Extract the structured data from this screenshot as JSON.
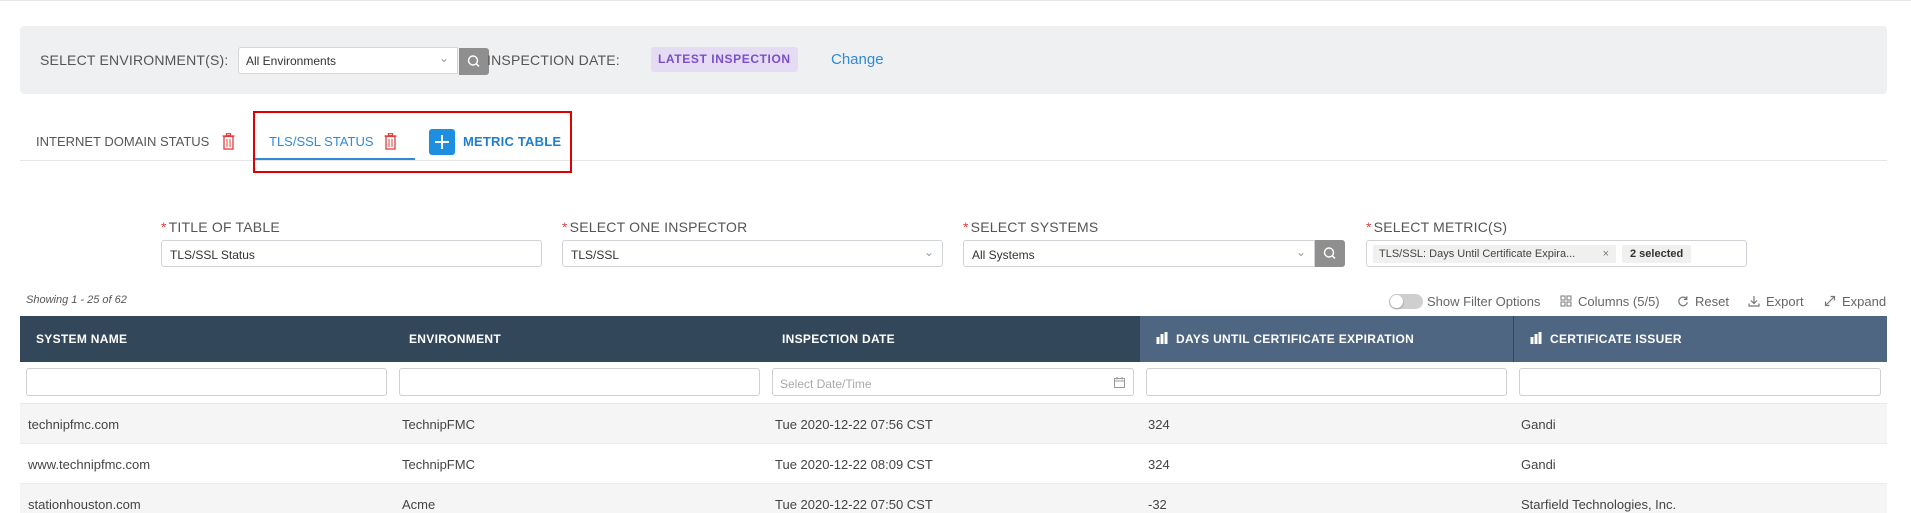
{
  "filter_bar": {
    "env_label": "SELECT ENVIRONMENT(S):",
    "env_value": "All Environments",
    "inspection_label": "INSPECTION DATE:",
    "inspection_badge": "LATEST INSPECTION",
    "change_link": "Change"
  },
  "tabs": [
    {
      "label": "INTERNET DOMAIN STATUS"
    },
    {
      "label": "TLS/SSL STATUS"
    }
  ],
  "add_tab_label": "METRIC TABLE",
  "form": {
    "title_label": "TITLE OF TABLE",
    "title_value": "TLS/SSL Status",
    "inspector_label": "SELECT ONE INSPECTOR",
    "inspector_value": "TLS/SSL",
    "systems_label": "SELECT SYSTEMS",
    "systems_value": "All Systems",
    "metrics_label": "SELECT METRIC(S)",
    "metrics_tag": "TLS/SSL: Days Until Certificate Expira...",
    "metrics_tag_remove": "×",
    "metrics_count": "2 selected"
  },
  "toolbar": {
    "showing": "Showing 1 - 25 of 62",
    "show_filter": "Show Filter Options",
    "columns": "Columns (5/5)",
    "reset": "Reset",
    "export": "Export",
    "expand": "Expand"
  },
  "table": {
    "columns": [
      "SYSTEM NAME",
      "ENVIRONMENT",
      "INSPECTION DATE",
      "DAYS UNTIL CERTIFICATE EXPIRATION",
      "CERTIFICATE ISSUER"
    ],
    "date_placeholder": "Select Date/Time",
    "rows": [
      [
        "technipfmc.com",
        "TechnipFMC",
        "Tue 2020-12-22 07:56 CST",
        "324",
        "Gandi"
      ],
      [
        "www.technipfmc.com",
        "TechnipFMC",
        "Tue 2020-12-22 08:09 CST",
        "324",
        "Gandi"
      ],
      [
        "stationhouston.com",
        "Acme",
        "Tue 2020-12-22 07:50 CST",
        "-32",
        "Starfield Technologies, Inc."
      ]
    ]
  },
  "colors": {
    "accent": "#2f8ad8",
    "table_header": "#33475b",
    "metric_header": "#4f6683",
    "badge_bg": "#e5dcf4",
    "badge_text": "#7b4fc9",
    "highlight": "#e00000",
    "danger": "#e03c3c"
  }
}
